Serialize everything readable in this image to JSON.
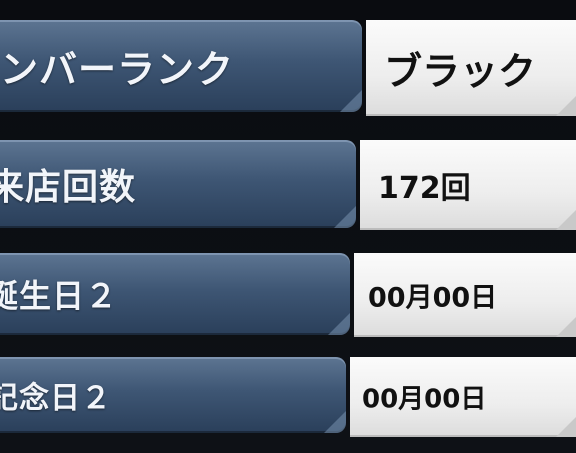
{
  "rows": [
    {
      "label": "ンバーランク",
      "value": "ブラック"
    },
    {
      "label": "来店回数",
      "value": "172回"
    },
    {
      "label": "誕生日２",
      "value": "00月00日"
    },
    {
      "label": "記念日２",
      "value": "00月00日"
    }
  ]
}
